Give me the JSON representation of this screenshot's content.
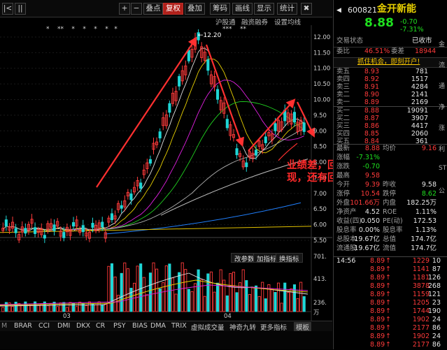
{
  "toolbar": {
    "buttons": [
      "|<",
      "||",
      "+",
      "−",
      "叠点",
      "复权",
      "叠加",
      "筹码",
      "画线",
      "显示",
      "统计",
      "✖"
    ],
    "sub_tabs": [
      "沪股通",
      "融资融券",
      "设置均线"
    ]
  },
  "chart": {
    "price_ticks": [
      "12.00",
      "11.50",
      "11.00",
      "10.50",
      "10.00",
      "9.50",
      "9.00",
      "8.50",
      "8.00",
      "7.50",
      "7.00",
      "6.50",
      "6.00",
      "5.50"
    ],
    "high_label": "12.20",
    "low_label": "5.50",
    "stars_left": "*    **    *    *    *    *   *",
    "stars_right": "***    **",
    "volume_ticks": [
      "701.",
      "413.",
      "236.",
      "万"
    ],
    "volume_buttons": [
      "改参数",
      "加指标",
      "换指标"
    ],
    "time_ticks": [
      "03",
      "04"
    ],
    "indicator_tabs": [
      "BRAR",
      "CCI",
      "DMI",
      "DKX",
      "CR",
      "PSY",
      "BIAS",
      "DMA",
      "TRIX",
      "虚拟成交量",
      "神奇九转",
      "更多指标",
      "模板"
    ],
    "annotation": "业绩差，回调是打前面利润的高位套现，还有回调风险。",
    "colors": {
      "up": "#ff3b3b",
      "down": "#1fd6d6",
      "ma5": "#e0e0e0",
      "ma10": "#e8d000",
      "ma20": "#e020e0",
      "ma30": "#20d020",
      "ma60": "#b0b0b0",
      "ma120": "#2080ff",
      "ma250": "#e0c000"
    }
  },
  "quote": {
    "code": "600821",
    "name": "金开新能",
    "price": "8.88",
    "change": "-0.70",
    "pct": "-7.31%",
    "status_label": "交易状态",
    "status_value": "已收市",
    "ratio_label": "委比",
    "ratio_value": "46.51%",
    "diff_label": "委差",
    "diff_value": "18944",
    "ad_text": "抓住机会，即刻开户!",
    "asks": [
      {
        "label": "卖五",
        "price": "8.93",
        "vol": "781"
      },
      {
        "label": "卖四",
        "price": "8.92",
        "vol": "1517"
      },
      {
        "label": "卖三",
        "price": "8.91",
        "vol": "4284"
      },
      {
        "label": "卖二",
        "price": "8.90",
        "vol": "2141"
      },
      {
        "label": "卖一",
        "price": "8.89",
        "vol": "2169"
      }
    ],
    "bids": [
      {
        "label": "买一",
        "price": "8.88",
        "vol": "19091"
      },
      {
        "label": "买二",
        "price": "8.87",
        "vol": "3907"
      },
      {
        "label": "买三",
        "price": "8.86",
        "vol": "4417"
      },
      {
        "label": "买四",
        "price": "8.85",
        "vol": "2060"
      },
      {
        "label": "买五",
        "price": "8.84",
        "vol": "361"
      }
    ],
    "stats": [
      {
        "l1": "最新",
        "v1": "8.88",
        "l2": "均价",
        "v2": "9.16"
      },
      {
        "l1": "涨幅",
        "v1": "-7.31%",
        "l2": "",
        "v2": ""
      },
      {
        "l1": "涨跌",
        "v1": "-0.70",
        "l2": "",
        "v2": ""
      },
      {
        "l1": "最高",
        "v1": "9.58",
        "l2": "",
        "v2": ""
      },
      {
        "l1": "今开",
        "v1": "9.39",
        "l2": "昨收",
        "v2": "9.58"
      },
      {
        "l1": "涨停",
        "v1": "10.54",
        "l2": "跌停",
        "v2": "8.62"
      },
      {
        "l1": "外盘",
        "v1": "101.66万",
        "l2": "内盘",
        "v2": "182.25万"
      },
      {
        "l1": "净资产",
        "v1": "4.52",
        "l2": "ROE",
        "v2": "1.11%"
      },
      {
        "l1": "收益(四)",
        "v1": "0.050",
        "l2": "PE(动)",
        "v2": "172.53"
      },
      {
        "l1": "股息率",
        "v1": "0.00%",
        "l2": "股息率",
        "v2": "1.13%"
      },
      {
        "l1": "总股本",
        "v1": "19.67亿",
        "l2": "总值",
        "v2": "174.7亿"
      },
      {
        "l1": "流通股",
        "v1": "19.67亿",
        "l2": "流值",
        "v2": "174.7亿"
      }
    ],
    "ticks": [
      {
        "t": "14:56",
        "p": "8.89",
        "v": "1229",
        "n": "10"
      },
      {
        "t": "",
        "p": "8.89",
        "v": "1141",
        "n": "87"
      },
      {
        "t": "",
        "p": "8.89",
        "v": "1181",
        "n": "126"
      },
      {
        "t": "",
        "p": "8.89",
        "v": "3878",
        "n": "268"
      },
      {
        "t": "",
        "p": "8.89",
        "v": "1159",
        "n": "121"
      },
      {
        "t": "",
        "p": "8.89",
        "v": "1205",
        "n": "23"
      },
      {
        "t": "",
        "p": "8.89",
        "v": "1744",
        "n": "190"
      },
      {
        "t": "",
        "p": "8.89",
        "v": "1902",
        "n": "24"
      },
      {
        "t": "",
        "p": "8.89",
        "v": "2177",
        "n": "86"
      },
      {
        "t": "",
        "p": "8.89",
        "v": "1902",
        "n": "24"
      },
      {
        "t": "",
        "p": "8.89",
        "v": "2177",
        "n": "86"
      }
    ],
    "edge_text": [
      "金",
      "流",
      "通",
      "净",
      "涨",
      "利",
      "ST",
      "公"
    ]
  }
}
